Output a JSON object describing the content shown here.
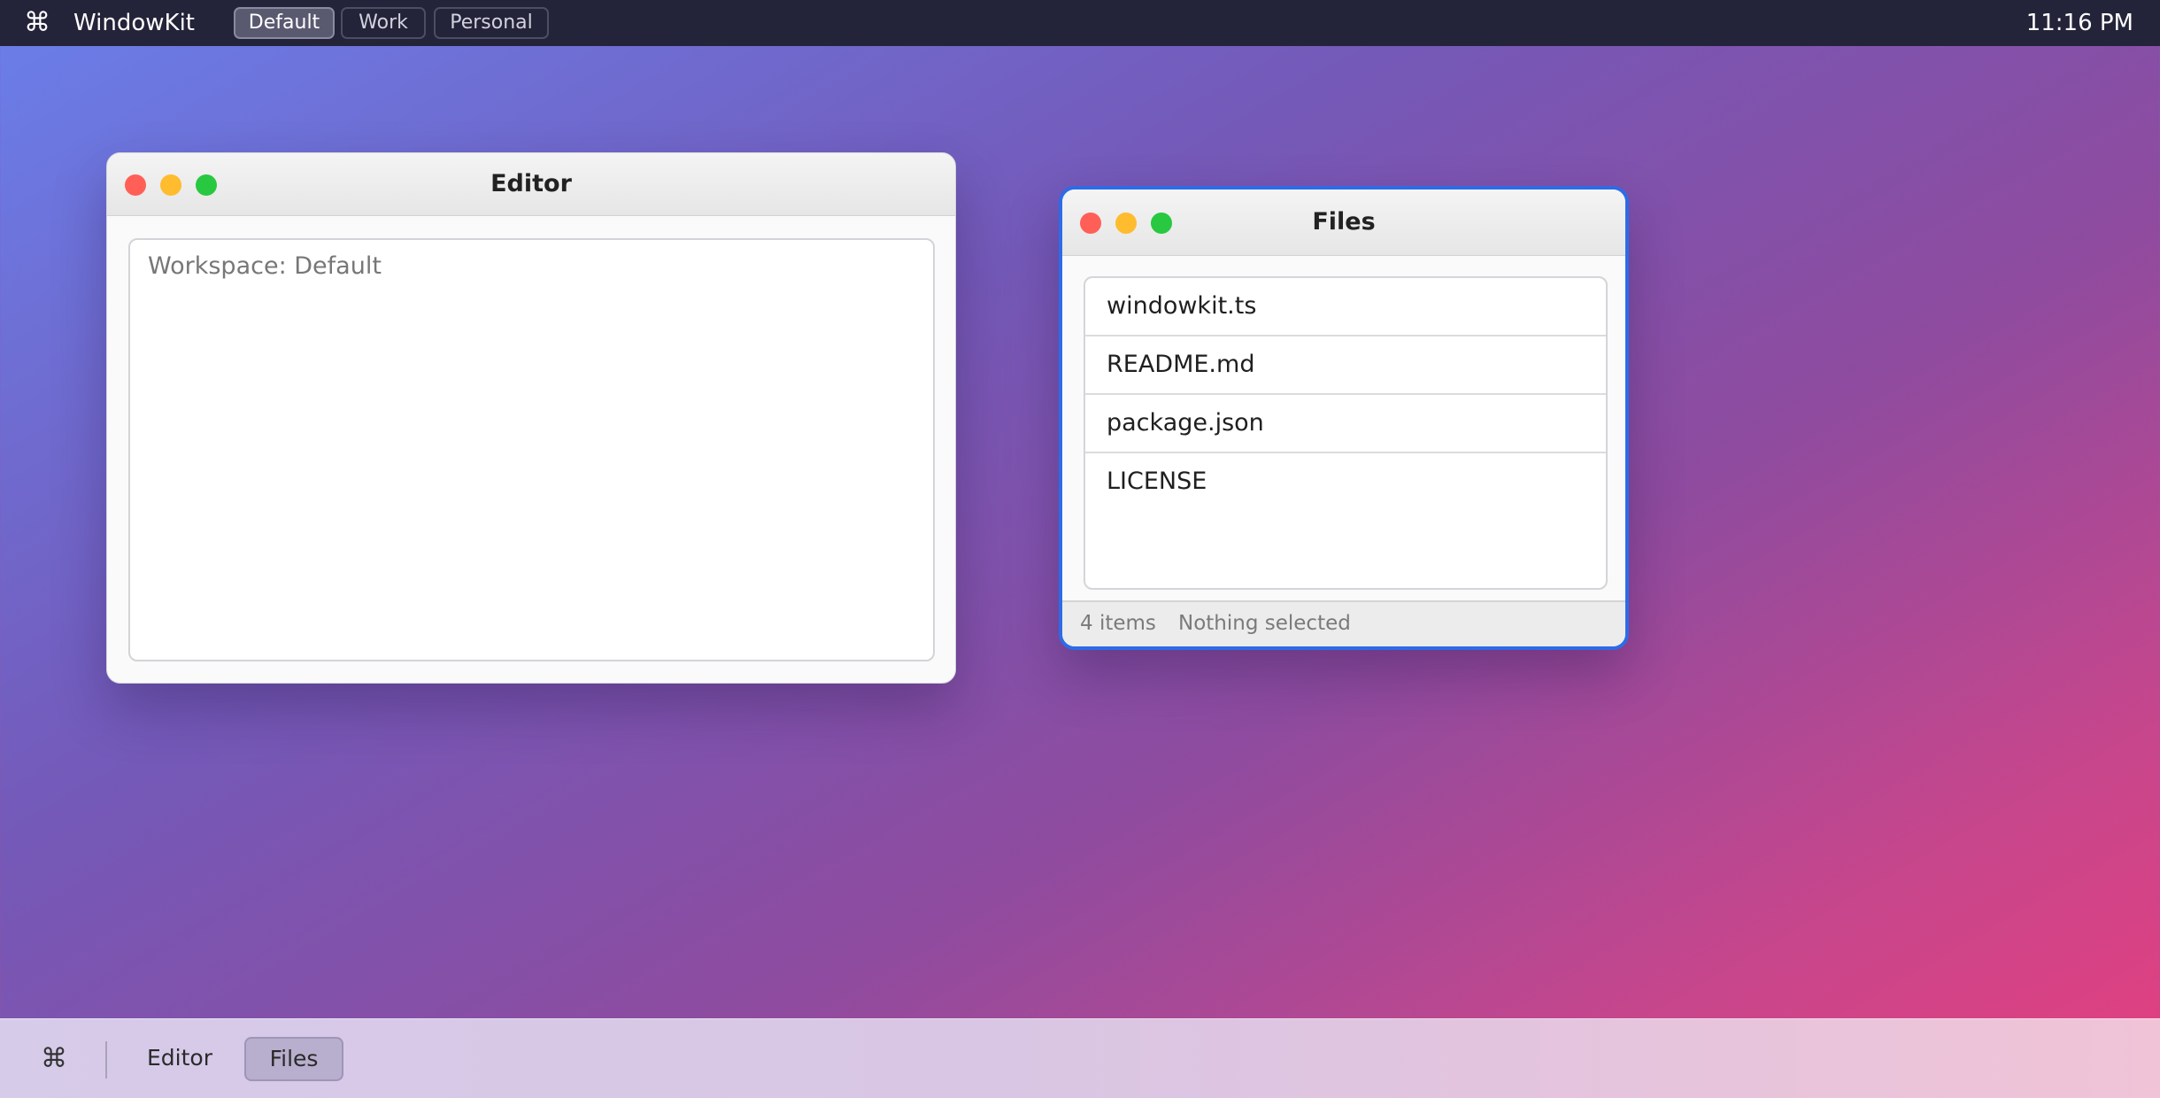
{
  "menubar": {
    "logo_glyph": "⌘",
    "app_name": "WindowKit",
    "workspaces": [
      {
        "label": "Default",
        "active": true
      },
      {
        "label": "Work",
        "active": false
      },
      {
        "label": "Personal",
        "active": false
      }
    ],
    "clock": "11:16 PM"
  },
  "editor": {
    "title": "Editor",
    "content": "Workspace: Default"
  },
  "files": {
    "title": "Files",
    "items": [
      "windowkit.ts",
      "README.md",
      "package.json",
      "LICENSE"
    ],
    "status_count": "4 items",
    "status_selection": "Nothing selected"
  },
  "dock": {
    "logo_glyph": "⌘",
    "items": [
      {
        "label": "Editor",
        "active": false
      },
      {
        "label": "Files",
        "active": true
      }
    ]
  },
  "colors": {
    "accent": "#2d6be7",
    "close": "#ff5f57",
    "minimize": "#febc2e",
    "zoom": "#28c840",
    "menubar": "#232339"
  }
}
